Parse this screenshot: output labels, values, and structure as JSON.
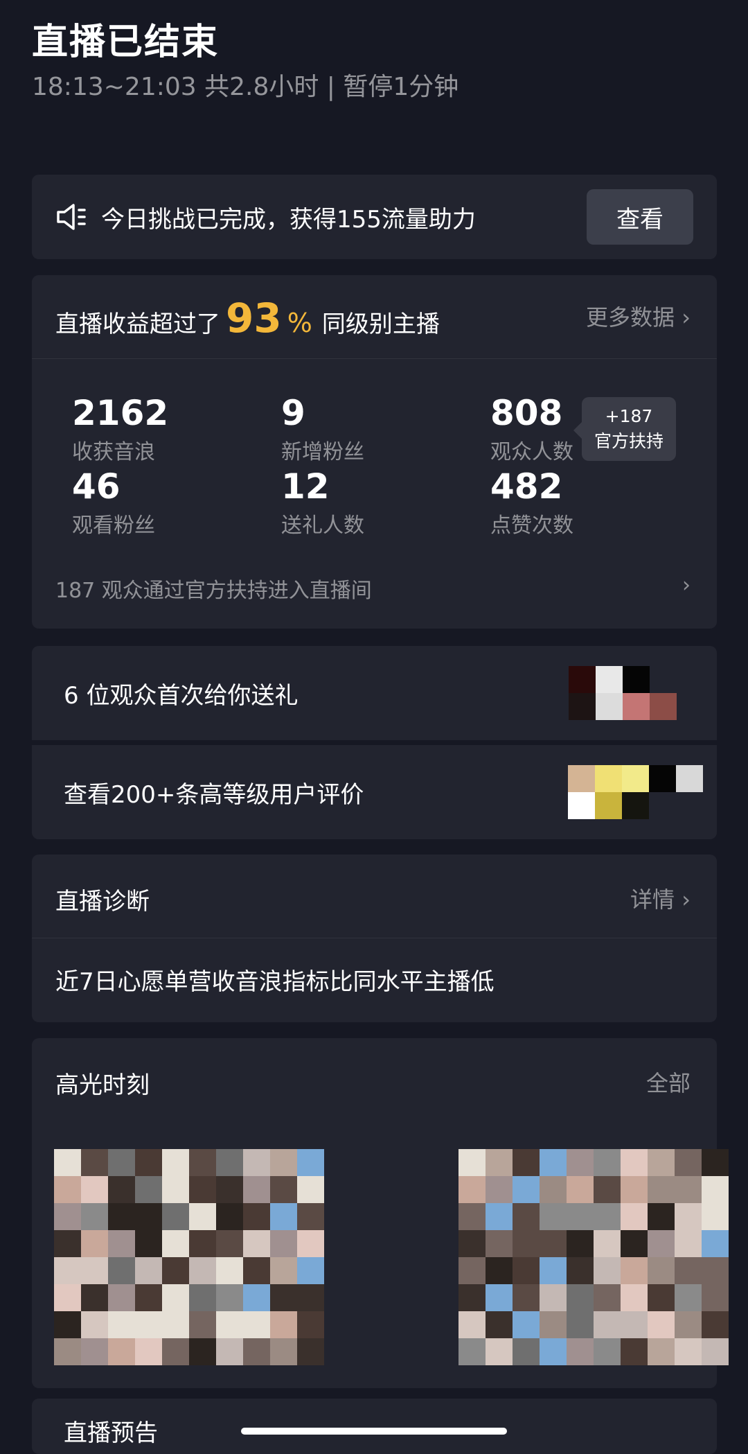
{
  "header": {
    "title": "直播已结束",
    "subtitle": "18:13~21:03 共2.8小时 | 暂停1分钟"
  },
  "challenge": {
    "text": "今日挑战已完成，获得155流量助力",
    "button": "查看"
  },
  "stats": {
    "lead": "直播收益超过了",
    "percent": "93",
    "percent_sign": "%",
    "tail": "同级别主播",
    "more": "更多数据 ›",
    "items": [
      {
        "value": "2162",
        "label": "收获音浪"
      },
      {
        "value": "9",
        "label": "新增粉丝"
      },
      {
        "value": "808",
        "label": "观众人数"
      },
      {
        "value": "46",
        "label": "观看粉丝"
      },
      {
        "value": "12",
        "label": "送礼人数"
      },
      {
        "value": "482",
        "label": "点赞次数"
      }
    ],
    "tooltip_line1": "+187",
    "tooltip_line2": "官方扶持",
    "footer": "187 观众通过官方扶持进入直播间",
    "footer_arrow": "›"
  },
  "gifts": {
    "first_gift_text": "6 位观众首次给你送礼",
    "reviews_text": "查看200+条高等级用户评价"
  },
  "diagnosis": {
    "title": "直播诊断",
    "more": "详情 ›",
    "message": "近7日心愿单营收音浪指标比同水平主播低"
  },
  "highlights": {
    "title": "高光时刻",
    "more": "全部"
  },
  "preview": {
    "title": "直播预告"
  },
  "colors": {
    "background": "#161823",
    "card": "#22242f",
    "accent": "#f3b73a"
  }
}
